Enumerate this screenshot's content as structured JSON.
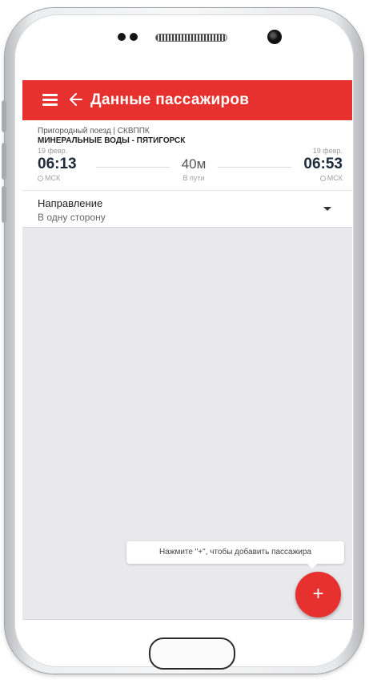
{
  "app_bar": {
    "title": "Данные пассажиров",
    "color": "#e6312e"
  },
  "trip": {
    "train_type": "Пригородный поезд | СКВППК",
    "route": "МИНЕРАЛЬНЫЕ ВОДЫ - ПЯТИГОРСК",
    "departure": {
      "date": "19 февр.",
      "time": "06:13",
      "timezone": "МСК"
    },
    "arrival": {
      "date": "19 февр.",
      "time": "06:53",
      "timezone": "МСК"
    },
    "duration": "40м",
    "duration_label": "В пути"
  },
  "direction": {
    "label": "Направление",
    "value": "В одну сторону"
  },
  "tooltip": {
    "text": "Нажмите \"+\", чтобы добавить пассажира"
  },
  "fab": {
    "label": "+"
  },
  "icons": {
    "menu": "menu-icon",
    "back": "arrow-left-icon",
    "dropdown": "caret-down-icon",
    "clock": "clock-icon"
  }
}
